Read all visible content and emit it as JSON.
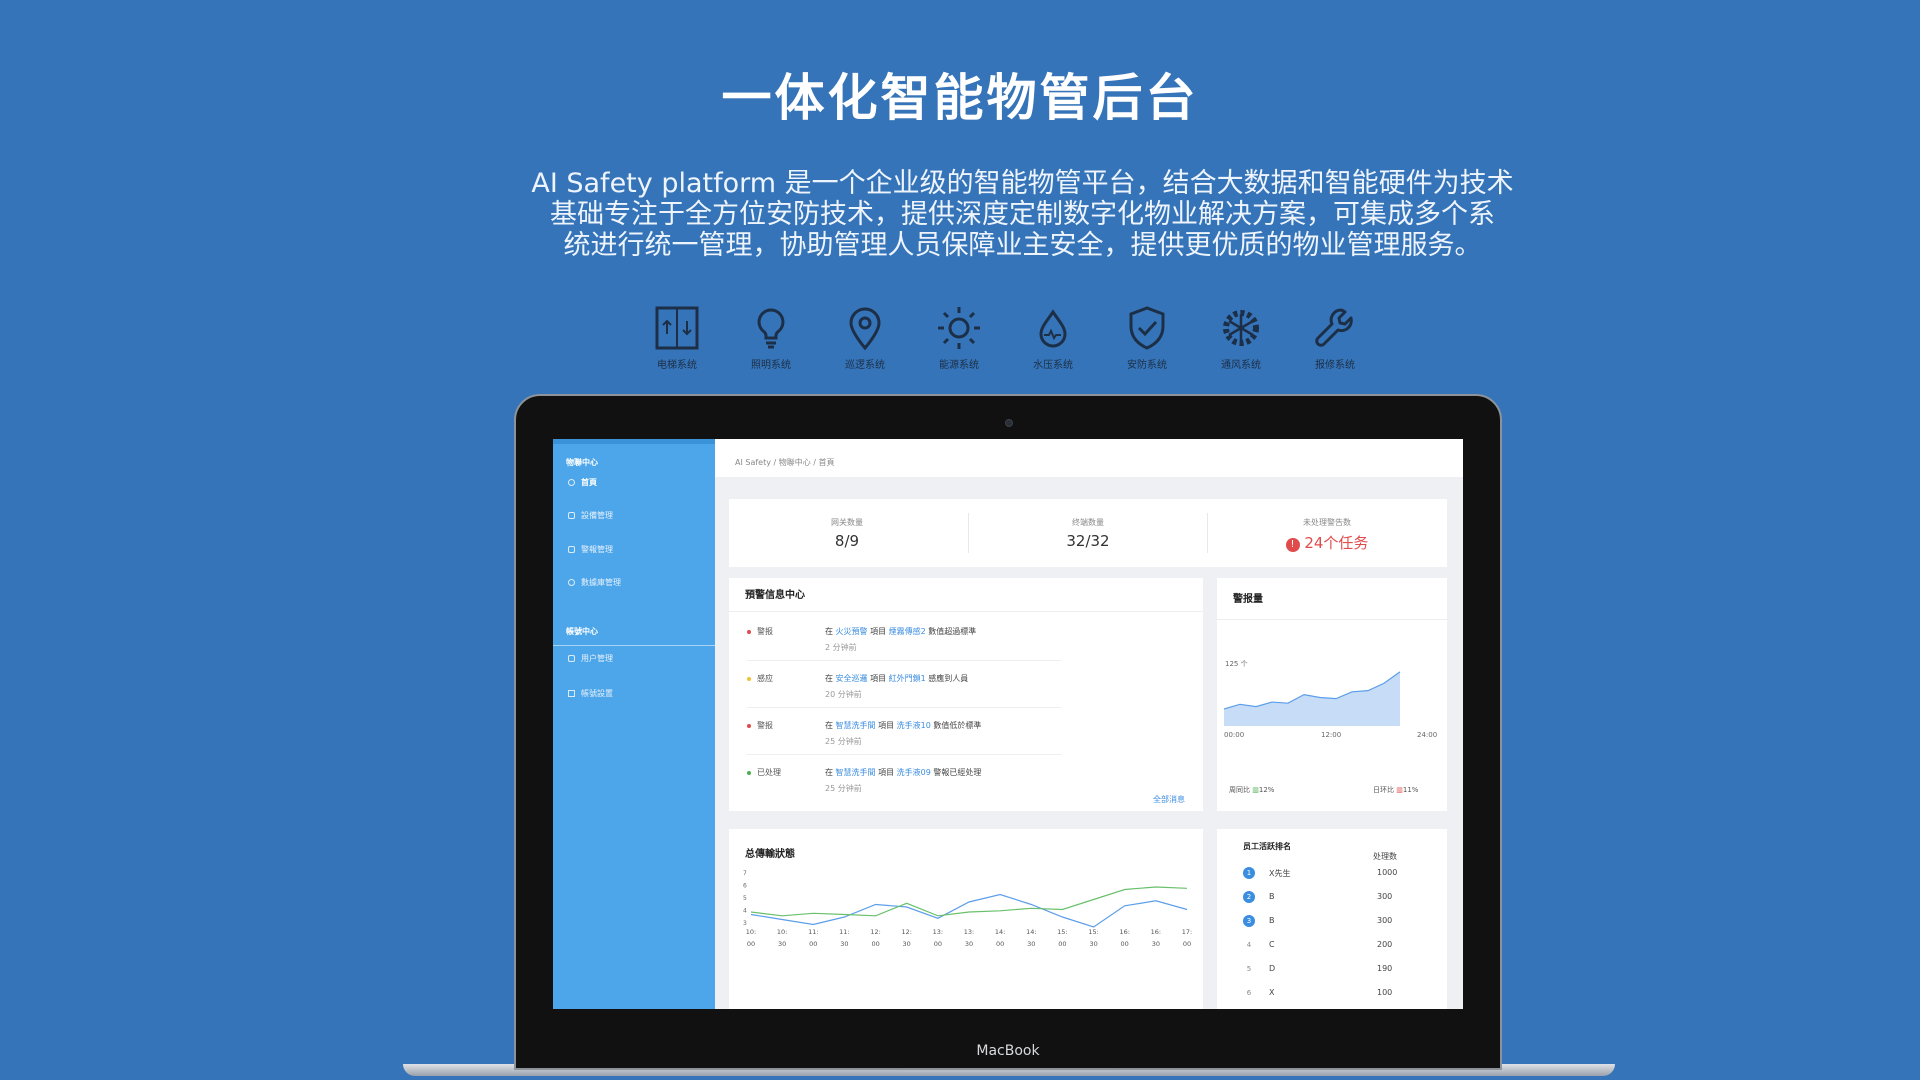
{
  "hero": {
    "title": "一体化智能物管后台",
    "desc_lines": [
      "AI Safety platform 是一个企业级的智能物管平台，结合大数据和智能硬件为技术",
      "基础专注于全方位安防技术，提供深度定制数字化物业解决方案，可集成多个系",
      "统进行统一管理，协助管理人员保障业主安全，提供更优质的物业管理服务。"
    ]
  },
  "systems": [
    {
      "label": "电梯系统",
      "icon": "elevator-icon"
    },
    {
      "label": "照明系统",
      "icon": "bulb-icon"
    },
    {
      "label": "巡逻系统",
      "icon": "location-pin-icon"
    },
    {
      "label": "能源系统",
      "icon": "sun-icon"
    },
    {
      "label": "水压系统",
      "icon": "water-drop-icon"
    },
    {
      "label": "安防系统",
      "icon": "shield-check-icon"
    },
    {
      "label": "通风系统",
      "icon": "fan-snowflake-icon"
    },
    {
      "label": "报修系统",
      "icon": "wrench-icon"
    }
  ],
  "laptop": {
    "brand": "MacBook"
  },
  "app": {
    "sidebar": {
      "section1": "物聯中心",
      "items1": [
        "首頁",
        "設備管理",
        "警報管理",
        "數據庫管理"
      ],
      "section2": "帳號中心",
      "items2": [
        "用户管理",
        "帳號設置"
      ]
    },
    "breadcrumb": "AI Safety / 物聯中心 / 首頁",
    "stats": [
      {
        "label": "网关数量",
        "value": "8/9"
      },
      {
        "label": "终端数量",
        "value": "32/32"
      },
      {
        "label": "未处理警告数",
        "value": "24个任务"
      }
    ],
    "alerts_title": "預警信息中心",
    "alerts": [
      {
        "tag": "警报",
        "color": "#e04b4b",
        "pre": "在",
        "sys": "火災預警",
        "mid": "項目",
        "dev": "煙霧傳感2",
        "post": "數值超過標準",
        "time": "2 分钟前"
      },
      {
        "tag": "感应",
        "color": "#f1c232",
        "pre": "在",
        "sys": "安全巡邏",
        "mid": "項目",
        "dev": "紅外門鎖1",
        "post": "感應到人員",
        "time": "20 分钟前"
      },
      {
        "tag": "警报",
        "color": "#e04b4b",
        "pre": "在",
        "sys": "智慧洗手間",
        "mid": "項目",
        "dev": "洗手液10",
        "post": "數值低於標準",
        "time": "25 分钟前"
      },
      {
        "tag": "已处理",
        "color": "#4caf50",
        "pre": "在",
        "sys": "智慧洗手間",
        "mid": "項目",
        "dev": "洗手液09",
        "post": "警報已經处理",
        "time": "25 分钟前"
      }
    ],
    "alerts_link": "全部消息",
    "alarm_card": {
      "title": "警报量",
      "unit": "125 个",
      "x_labels": [
        "00:00",
        "12:00",
        "24:00"
      ],
      "week_label": "周同比",
      "week_value": "12%",
      "day_label": "日环比",
      "day_value": "11%",
      "week_color": "#4caf50",
      "day_color": "#e04b4b"
    },
    "transfer_title": "总傳輸狀態",
    "ranking": {
      "title": "员工活跃排名",
      "col": "处理数",
      "rows": [
        {
          "rank": "1",
          "name": "X先生",
          "count": "1000"
        },
        {
          "rank": "2",
          "name": "B",
          "count": "300"
        },
        {
          "rank": "3",
          "name": "B",
          "count": "300"
        },
        {
          "rank": "4",
          "name": "C",
          "count": "200"
        },
        {
          "rank": "5",
          "name": "D",
          "count": "190"
        },
        {
          "rank": "6",
          "name": "X",
          "count": "100"
        }
      ]
    }
  },
  "chart_data": [
    {
      "type": "area",
      "title": "警报量",
      "x": [
        "00:00",
        "12:00",
        "24:00"
      ],
      "series": [
        {
          "values": [
            30,
            38,
            34,
            42,
            40,
            55,
            50,
            48,
            60,
            62,
            75,
            95
          ]
        }
      ],
      "grid": false
    },
    {
      "type": "line",
      "title": "总傳輸狀態",
      "categories": [
        "10:00",
        "10:30",
        "11:00",
        "11:30",
        "12:00",
        "12:30",
        "13:00",
        "13:30",
        "14:00",
        "14:30",
        "15:00",
        "15:30",
        "16:00",
        "16:30",
        "17:00"
      ],
      "series": [
        {
          "values": [
            3.6,
            3.2,
            2.8,
            3.4,
            4.4,
            4.2,
            3.3,
            4.6,
            5.2,
            4.4,
            3.4,
            2.6,
            4.3,
            4.7,
            4.0
          ]
        },
        {
          "values": [
            3.8,
            3.5,
            3.7,
            3.6,
            3.5,
            4.5,
            3.5,
            3.8,
            3.9,
            4.1,
            4.0,
            4.8,
            5.6,
            5.8,
            5.7
          ]
        }
      ],
      "y_ticks": [
        "7",
        "6",
        "5",
        "4",
        "3"
      ],
      "colors": [
        "#5b9ee9",
        "#69c06b"
      ]
    }
  ]
}
